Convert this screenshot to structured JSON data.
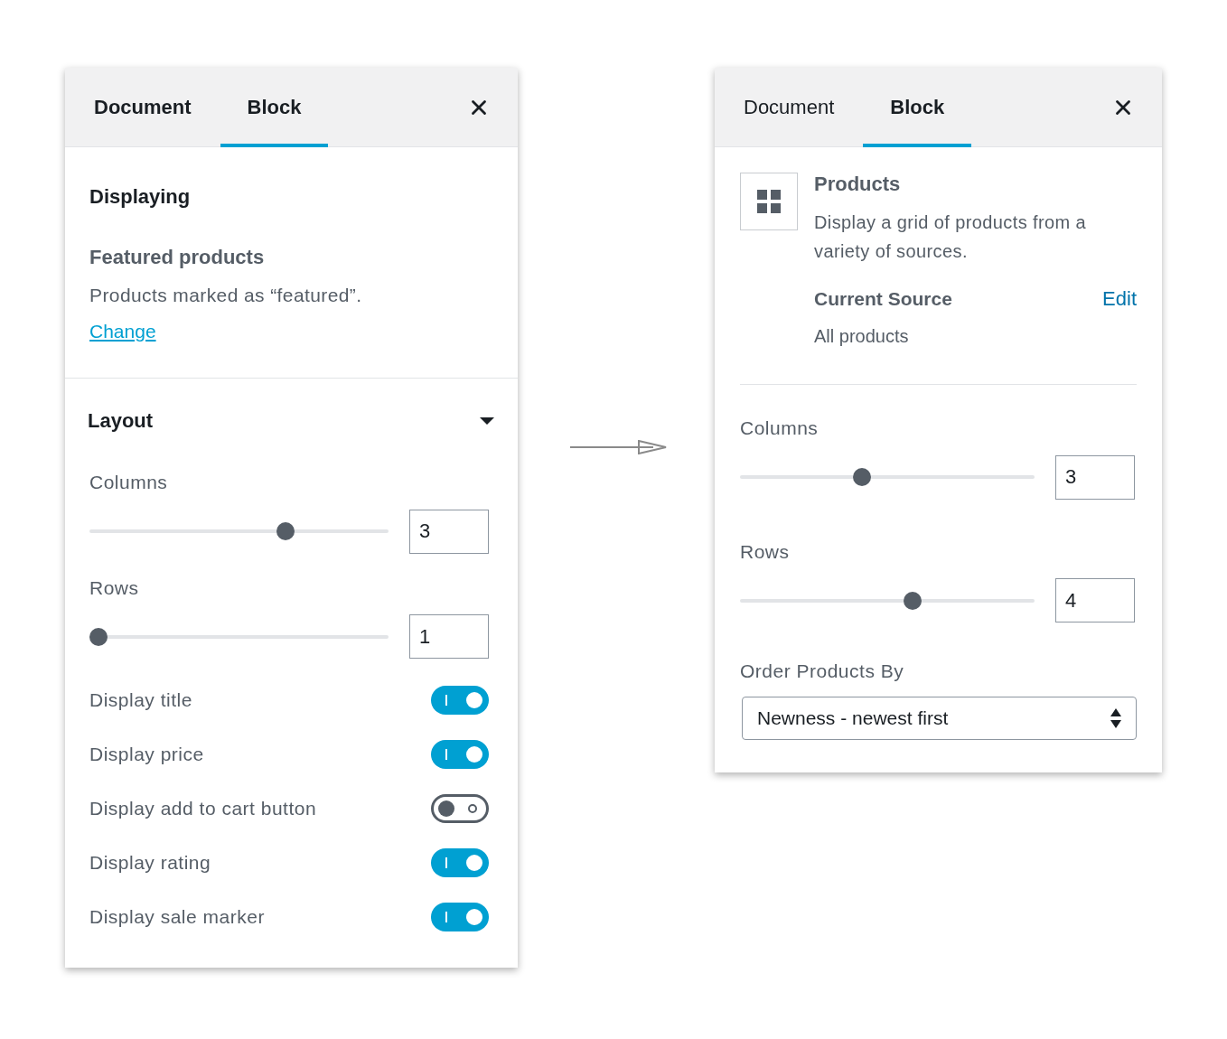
{
  "left_panel": {
    "tabs": [
      {
        "label": "Document",
        "selected": false
      },
      {
        "label": "Block",
        "selected": true
      }
    ],
    "displaying": {
      "heading": "Displaying",
      "title": "Featured products",
      "description": "Products marked as “featured”.",
      "link": "Change"
    },
    "layout": {
      "heading": "Layout",
      "expanded": true,
      "columns": {
        "label": "Columns",
        "value": "3",
        "level": 0.667
      },
      "rows": {
        "label": "Rows",
        "value": "1",
        "level": 0
      },
      "toggles": [
        {
          "label": "Display title",
          "on": true
        },
        {
          "label": "Display price",
          "on": true
        },
        {
          "label": "Display add to cart button",
          "on": false
        },
        {
          "label": "Display rating",
          "on": true
        },
        {
          "label": "Display sale marker",
          "on": true
        }
      ]
    }
  },
  "right_panel": {
    "tabs": [
      {
        "label": "Document",
        "selected": false
      },
      {
        "label": "Block",
        "selected": true
      }
    ],
    "block_info": {
      "title": "Products",
      "description": "Display a grid of products from a variety of sources.",
      "source_label": "Current Source",
      "edit_link": "Edit",
      "source_value": "All products"
    },
    "columns": {
      "label": "Columns",
      "value": "3",
      "level": 0.41
    },
    "rows": {
      "label": "Rows",
      "value": "4",
      "level": 0.59
    },
    "order_by": {
      "label": "Order Products By",
      "value": "Newness - newest first"
    }
  }
}
